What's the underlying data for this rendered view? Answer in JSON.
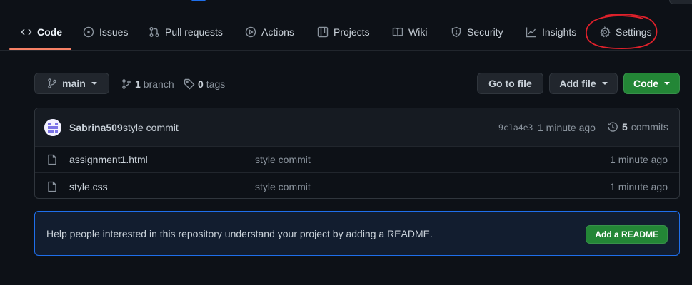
{
  "colors": {
    "background": "#0d1117",
    "active_tab_underline": "#f78166",
    "green_button": "#238636",
    "banner_border": "#1f6feb",
    "annotation": "#e0212b"
  },
  "tabs": [
    {
      "label": "Code",
      "icon": "code-icon",
      "active": true
    },
    {
      "label": "Issues",
      "icon": "issue-opened-icon",
      "active": false
    },
    {
      "label": "Pull requests",
      "icon": "pull-request-icon",
      "active": false
    },
    {
      "label": "Actions",
      "icon": "play-icon",
      "active": false
    },
    {
      "label": "Projects",
      "icon": "table-icon",
      "active": false
    },
    {
      "label": "Wiki",
      "icon": "book-icon",
      "active": false
    },
    {
      "label": "Security",
      "icon": "shield-icon",
      "active": false
    },
    {
      "label": "Insights",
      "icon": "graph-icon",
      "active": false
    },
    {
      "label": "Settings",
      "icon": "gear-icon",
      "active": false
    }
  ],
  "branch_bar": {
    "branch_button": "main",
    "branches_count": "1",
    "branches_label": "branch",
    "tags_count": "0",
    "tags_label": "tags",
    "go_to_file": "Go to file",
    "add_file": "Add file",
    "code_button": "Code"
  },
  "latest_commit": {
    "author": "Sabrina509",
    "message": "style commit",
    "sha": "9c1a4e3",
    "time": "1 minute ago",
    "commits_count": "5",
    "commits_label": "commits"
  },
  "files": [
    {
      "name": "assignment1.html",
      "commit": "style commit",
      "time": "1 minute ago",
      "icon": "file-icon"
    },
    {
      "name": "style.css",
      "commit": "style commit",
      "time": "1 minute ago",
      "icon": "file-icon"
    }
  ],
  "readme_banner": {
    "text": "Help people interested in this repository understand your project by adding a README.",
    "button": "Add a README"
  }
}
